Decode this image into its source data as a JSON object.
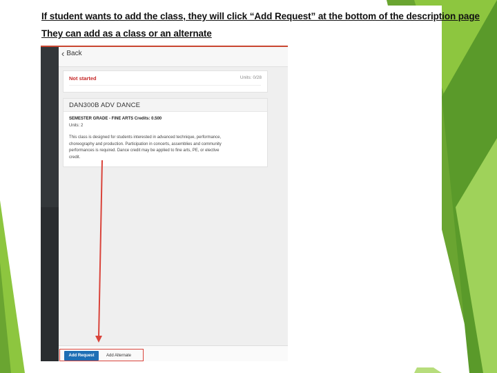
{
  "slide": {
    "heading_line1": "If student wants to add the class, they will click “Add Request” at the bottom of the description page",
    "heading_line2": "They can add as a class or an alternate",
    "accent_color": "#7cc245"
  },
  "screenshot": {
    "back_label": "Back",
    "status": "Not started",
    "units_top": "Units: 0/28",
    "course_title": "DAN300B   ADV DANCE",
    "grade_credits": "SEMESTER GRADE - FINE ARTS Credits: 0.500",
    "units": "Units: 2",
    "description_lines": [
      "This class is designed for students interested in advanced technique, performance,",
      "choreography and production. Participation in concerts, assemblies and community",
      "performances is required. Dance credit may be applied to fine arts, PE, or elective",
      "credit."
    ],
    "add_request_label": "Add Request",
    "add_alternate_label": "Add Alternate",
    "primary_button_color": "#1e6fb5",
    "status_color": "#c62828",
    "annotation_color": "#d9433a"
  }
}
